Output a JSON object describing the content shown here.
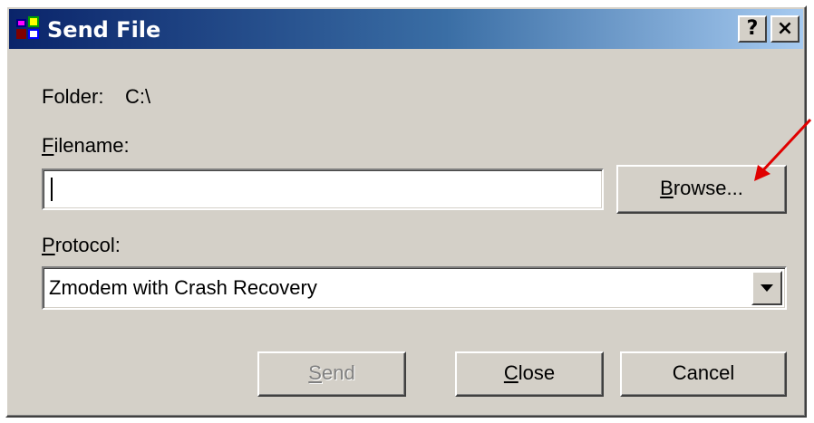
{
  "window": {
    "title": "Send File",
    "help_label": "?",
    "close_label": "×"
  },
  "form": {
    "folder_label": "Folder:",
    "folder_value": "C:\\",
    "filename_label_first": "F",
    "filename_label_rest": "ilename:",
    "filename_value": "",
    "protocol_label_first": "P",
    "protocol_label_rest": "rotocol:",
    "protocol_value": "Zmodem with Crash Recovery"
  },
  "buttons": {
    "browse_first": "B",
    "browse_rest": "rowse...",
    "send_first": "S",
    "send_rest": "end",
    "close_first": "C",
    "close_rest": "lose",
    "cancel": "Cancel"
  },
  "annotation": {
    "arrow_color": "#e00000"
  },
  "colors": {
    "face": "#d4d0c8",
    "title_start": "#0a246a",
    "title_end": "#a6caf0"
  }
}
